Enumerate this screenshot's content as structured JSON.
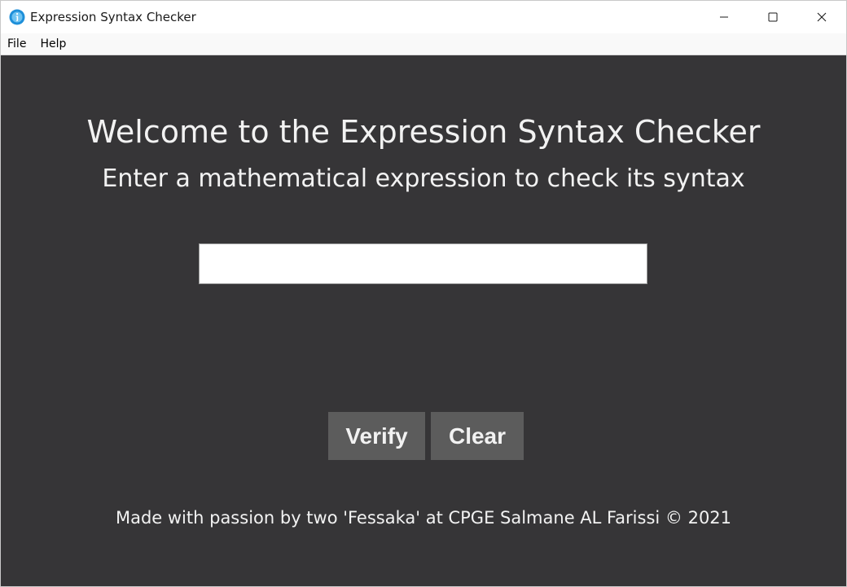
{
  "window": {
    "title": "Expression Syntax Checker",
    "icon": "info-icon",
    "controls": [
      "minimize-icon",
      "maximize-icon",
      "close-icon"
    ]
  },
  "menubar": {
    "items": [
      {
        "label": "File"
      },
      {
        "label": "Help"
      }
    ]
  },
  "main": {
    "heading": "Welcome to the Expression Syntax Checker",
    "subheading": "Enter a mathematical expression to check its syntax",
    "expression_input": {
      "value": "",
      "placeholder": ""
    },
    "verify_label": "Verify",
    "clear_label": "Clear",
    "footer": "Made with passion by two 'Fessaka' at CPGE Salmane AL Farissi © 2021"
  },
  "colors": {
    "background": "#363537",
    "button": "#5c5c5c",
    "text": "#f2f2f2",
    "app_icon": "#1e8fd9"
  }
}
